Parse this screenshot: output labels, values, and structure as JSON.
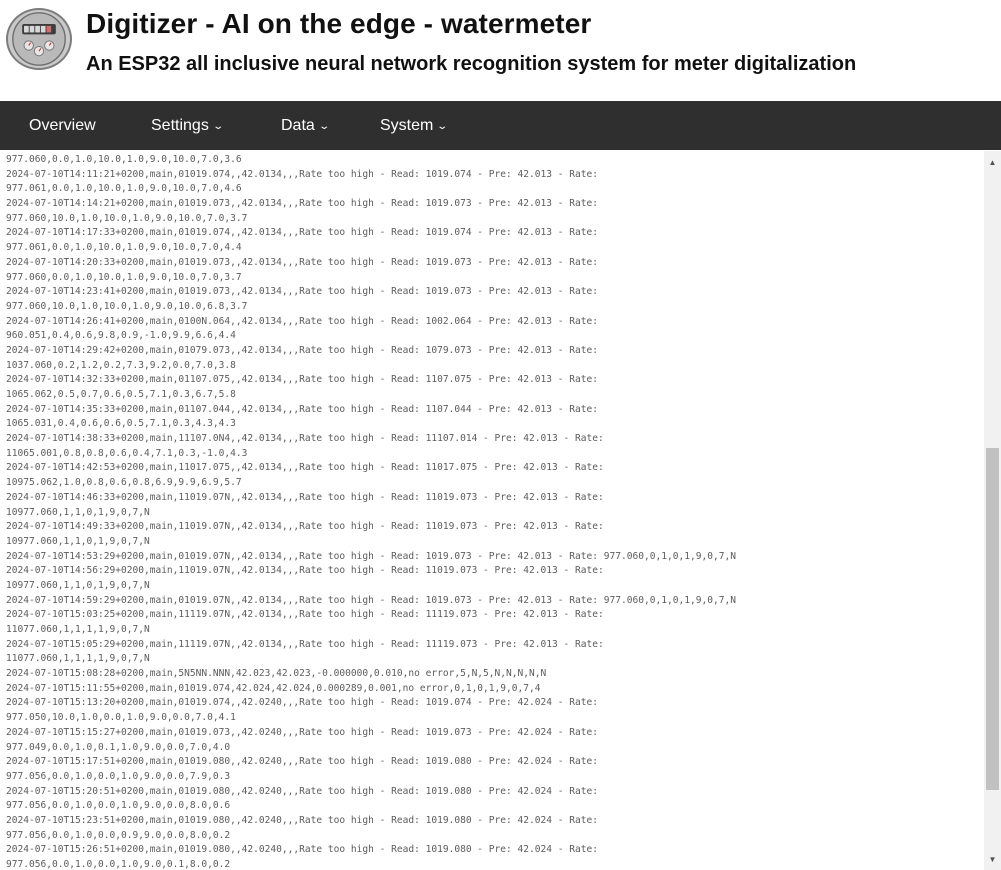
{
  "header": {
    "title": "Digitizer - AI on the edge - watermeter",
    "subtitle": "An ESP32 all inclusive neural network recognition system for meter digitalization"
  },
  "nav": {
    "overview": "Overview",
    "settings": "Settings",
    "data": "Data",
    "system": "System"
  },
  "icons": {
    "logo": "meter-logo-icon",
    "chevron": "chevron-down-icon",
    "scroll_up": "scroll-up-arrow-icon",
    "scroll_down": "scroll-down-arrow-icon"
  },
  "log": {
    "lines": [
      "977.060,0.0,1.0,10.0,1.0,9.0,10.0,7.0,3.6",
      "2024-07-10T14:11:21+0200,main,01019.074,,42.0134,,,Rate too high - Read: 1019.074 - Pre: 42.013 - Rate:",
      "977.061,0.0,1.0,10.0,1.0,9.0,10.0,7.0,4.6",
      "2024-07-10T14:14:21+0200,main,01019.073,,42.0134,,,Rate too high - Read: 1019.073 - Pre: 42.013 - Rate:",
      "977.060,10.0,1.0,10.0,1.0,9.0,10.0,7.0,3.7",
      "2024-07-10T14:17:33+0200,main,01019.074,,42.0134,,,Rate too high - Read: 1019.074 - Pre: 42.013 - Rate:",
      "977.061,0.0,1.0,10.0,1.0,9.0,10.0,7.0,4.4",
      "2024-07-10T14:20:33+0200,main,01019.073,,42.0134,,,Rate too high - Read: 1019.073 - Pre: 42.013 - Rate:",
      "977.060,0.0,1.0,10.0,1.0,9.0,10.0,7.0,3.7",
      "2024-07-10T14:23:41+0200,main,01019.073,,42.0134,,,Rate too high - Read: 1019.073 - Pre: 42.013 - Rate:",
      "977.060,10.0,1.0,10.0,1.0,9.0,10.0,6.8,3.7",
      "2024-07-10T14:26:41+0200,main,0100N.064,,42.0134,,,Rate too high - Read: 1002.064 - Pre: 42.013 - Rate:",
      "960.051,0.4,0.6,9.8,0.9,-1.0,9.9,6.6,4.4",
      "2024-07-10T14:29:42+0200,main,01079.073,,42.0134,,,Rate too high - Read: 1079.073 - Pre: 42.013 - Rate:",
      "1037.060,0.2,1.2,0.2,7.3,9.2,0.0,7.0,3.8",
      "2024-07-10T14:32:33+0200,main,01107.075,,42.0134,,,Rate too high - Read: 1107.075 - Pre: 42.013 - Rate:",
      "1065.062,0.5,0.7,0.6,0.5,7.1,0.3,6.7,5.8",
      "2024-07-10T14:35:33+0200,main,01107.044,,42.0134,,,Rate too high - Read: 1107.044 - Pre: 42.013 - Rate:",
      "1065.031,0.4,0.6,0.6,0.5,7.1,0.3,4.3,4.3",
      "2024-07-10T14:38:33+0200,main,11107.0N4,,42.0134,,,Rate too high - Read: 11107.014 - Pre: 42.013 - Rate:",
      "11065.001,0.8,0.8,0.6,0.4,7.1,0.3,-1.0,4.3",
      "2024-07-10T14:42:53+0200,main,11017.075,,42.0134,,,Rate too high - Read: 11017.075 - Pre: 42.013 - Rate:",
      "10975.062,1.0,0.8,0.6,0.8,6.9,9.9,6.9,5.7",
      "2024-07-10T14:46:33+0200,main,11019.07N,,42.0134,,,Rate too high - Read: 11019.073 - Pre: 42.013 - Rate:",
      "10977.060,1,1,0,1,9,0,7,N",
      "2024-07-10T14:49:33+0200,main,11019.07N,,42.0134,,,Rate too high - Read: 11019.073 - Pre: 42.013 - Rate:",
      "10977.060,1,1,0,1,9,0,7,N",
      "2024-07-10T14:53:29+0200,main,01019.07N,,42.0134,,,Rate too high - Read: 1019.073 - Pre: 42.013 - Rate: 977.060,0,1,0,1,9,0,7,N",
      "2024-07-10T14:56:29+0200,main,11019.07N,,42.0134,,,Rate too high - Read: 11019.073 - Pre: 42.013 - Rate:",
      "10977.060,1,1,0,1,9,0,7,N",
      "2024-07-10T14:59:29+0200,main,01019.07N,,42.0134,,,Rate too high - Read: 1019.073 - Pre: 42.013 - Rate: 977.060,0,1,0,1,9,0,7,N",
      "2024-07-10T15:03:25+0200,main,11119.07N,,42.0134,,,Rate too high - Read: 11119.073 - Pre: 42.013 - Rate:",
      "11077.060,1,1,1,1,9,0,7,N",
      "2024-07-10T15:05:29+0200,main,11119.07N,,42.0134,,,Rate too high - Read: 11119.073 - Pre: 42.013 - Rate:",
      "11077.060,1,1,1,1,9,0,7,N",
      "2024-07-10T15:08:28+0200,main,5N5NN.NNN,42.023,42.023,-0.000000,0.010,no error,5,N,5,N,N,N,N,N",
      "2024-07-10T15:11:55+0200,main,01019.074,42.024,42.024,0.000289,0.001,no error,0,1,0,1,9,0,7,4",
      "2024-07-10T15:13:20+0200,main,01019.074,,42.0240,,,Rate too high - Read: 1019.074 - Pre: 42.024 - Rate:",
      "977.050,10.0,1.0,0.0,1.0,9.0,0.0,7.0,4.1",
      "2024-07-10T15:15:27+0200,main,01019.073,,42.0240,,,Rate too high - Read: 1019.073 - Pre: 42.024 - Rate:",
      "977.049,0.0,1.0,0.1,1.0,9.0,0.0,7.0,4.0",
      "2024-07-10T15:17:51+0200,main,01019.080,,42.0240,,,Rate too high - Read: 1019.080 - Pre: 42.024 - Rate:",
      "977.056,0.0,1.0,0.0,1.0,9.0,0.0,7.9,0.3",
      "2024-07-10T15:20:51+0200,main,01019.080,,42.0240,,,Rate too high - Read: 1019.080 - Pre: 42.024 - Rate:",
      "977.056,0.0,1.0,0.0,1.0,9.0,0.0,8.0,0.6",
      "2024-07-10T15:23:51+0200,main,01019.080,,42.0240,,,Rate too high - Read: 1019.080 - Pre: 42.024 - Rate:",
      "977.056,0.0,1.0,0.0,0.9,9.0,0.0,8.0,0.2",
      "2024-07-10T15:26:51+0200,main,01019.080,,42.0240,,,Rate too high - Read: 1019.080 - Pre: 42.024 - Rate:",
      "977.056,0.0,1.0,0.0,1.0,9.0,0.1,8.0,0.2"
    ]
  },
  "colors": {
    "navbar_bg": "#2f2f2f",
    "nav_text": "#ffffff",
    "log_text": "#5c5c5c",
    "scrollbar_track": "#f1f1f1",
    "scrollbar_thumb": "#c1c1c1"
  }
}
